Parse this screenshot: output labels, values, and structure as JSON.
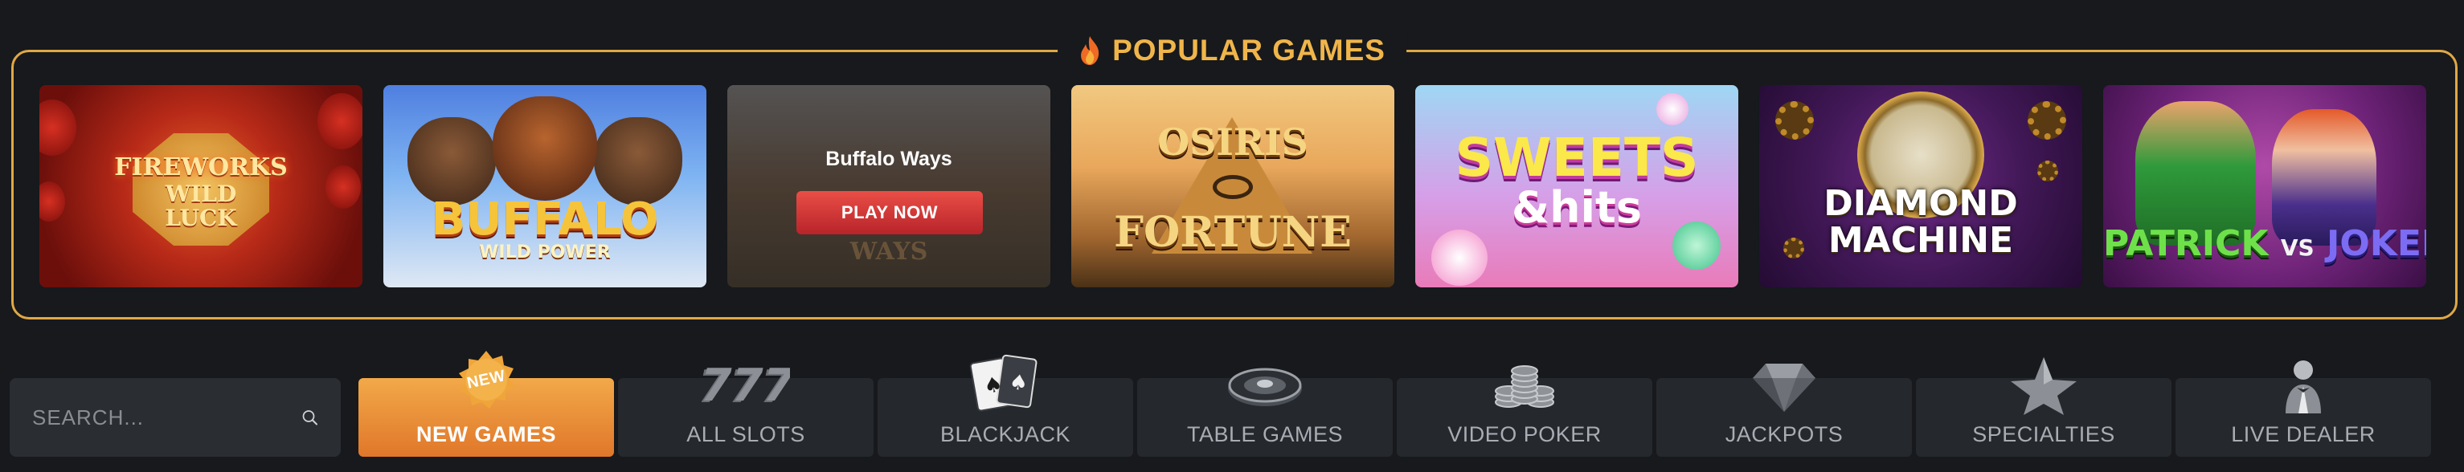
{
  "popular": {
    "title": "POPULAR GAMES",
    "icon": "fire-icon",
    "games": [
      {
        "title_lines": [
          "FIREWORKS",
          "WILD",
          "LUCK"
        ]
      },
      {
        "title": "BUFFALO",
        "subtitle": "WILD POWER"
      },
      {
        "hover_name": "Buffalo Ways",
        "play_label": "PLAY NOW",
        "background_word": "WAYS"
      },
      {
        "title_lines": [
          "OSIRIS",
          "FORTUNE"
        ]
      },
      {
        "title_lines": [
          "SWEETS",
          "&hits"
        ]
      },
      {
        "title_lines": [
          "DIAMOND",
          "MACHINE"
        ]
      },
      {
        "title_parts": [
          "PATRICK",
          "VS",
          "JOKER"
        ]
      }
    ]
  },
  "search": {
    "placeholder": "SEARCH...",
    "icon": "search-icon"
  },
  "nav": {
    "tabs": [
      {
        "label": "NEW GAMES",
        "icon": "new-badge",
        "badge": "NEW",
        "active": true
      },
      {
        "label": "ALL SLOTS",
        "icon": "slots-777-icon"
      },
      {
        "label": "BLACKJACK",
        "icon": "playing-cards-icon"
      },
      {
        "label": "TABLE GAMES",
        "icon": "roulette-wheel-icon"
      },
      {
        "label": "VIDEO POKER",
        "icon": "poker-chips-icon"
      },
      {
        "label": "JACKPOTS",
        "icon": "diamond-icon"
      },
      {
        "label": "SPECIALTIES",
        "icon": "star-icon"
      },
      {
        "label": "LIVE DEALER",
        "icon": "dealer-icon"
      }
    ]
  },
  "colors": {
    "accent": "#f0b54a",
    "active_tab_top": "#f2a949",
    "active_tab_bottom": "#e0772a",
    "background": "#17191c",
    "tab_background": "#25282c",
    "play_button": "#d9373a"
  }
}
